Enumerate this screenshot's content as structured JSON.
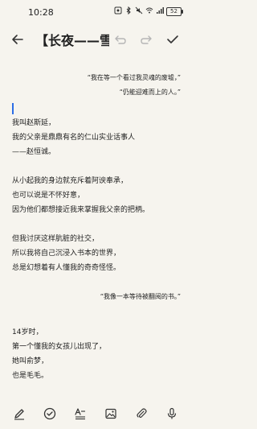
{
  "status_bar": {
    "time": "10:28",
    "battery": "52"
  },
  "toolbar": {
    "title": "【长夜——雪..."
  },
  "note": {
    "quote1_line1": "“我在等一个看过我灵魂的废墟，”",
    "quote1_line2": "“仍能迎难而上的人。”",
    "p1": [
      "我叫赵斯延，",
      "我的父亲是鼎鼎有名的仁山实业话事人",
      "——赵恒诚。"
    ],
    "p2": [
      "从小起我的身边就充斥着阿谀奉承，",
      "也可以说是不怀好意，",
      "因为他们都想接近我来掌握我父亲的把柄。"
    ],
    "p3": [
      "但我讨厌这样肮脏的社交，",
      "所以我将自己沉浸入书本的世界，",
      "总是幻想着有人懂我的奇奇怪怪。"
    ],
    "quote2": "“我像一本等待被翻阅的书。”",
    "p4": [
      "14岁时，",
      "第一个懂我的女孩儿出现了，",
      "她叫俞梦，",
      "也是毛毛。"
    ]
  },
  "icons": {
    "back": "arrow-left-icon",
    "undo": "undo-icon",
    "redo": "redo-icon",
    "confirm": "check-icon",
    "pen": "pen-icon",
    "checklist": "check-circle-icon",
    "text_style": "text-format-icon",
    "image": "image-icon",
    "attach": "paperclip-icon",
    "mic": "microphone-icon"
  }
}
